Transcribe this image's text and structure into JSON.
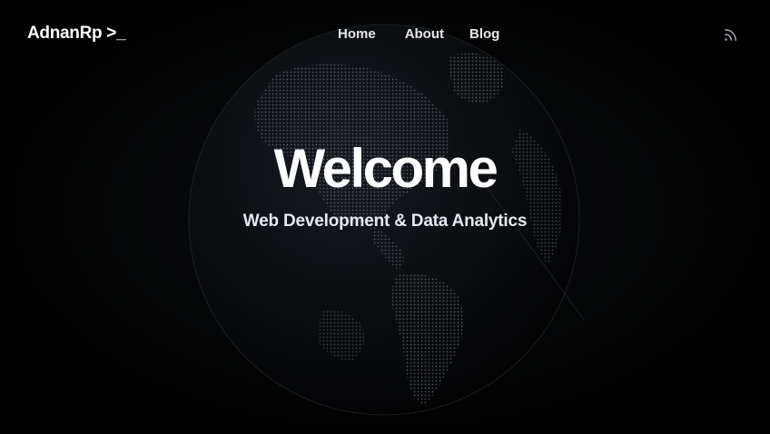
{
  "header": {
    "brand": "AdnanRp >_",
    "nav": [
      {
        "label": "Home"
      },
      {
        "label": "About"
      },
      {
        "label": "Blog"
      }
    ],
    "rss_icon": "rss-icon"
  },
  "hero": {
    "title": "Welcome",
    "subtitle": "Web Development & Data Analytics"
  },
  "background": {
    "image": "dotted-earth-globe",
    "colors": {
      "page": "#000000",
      "globe_dots": "#7f8a96",
      "text": "#ffffff"
    }
  }
}
